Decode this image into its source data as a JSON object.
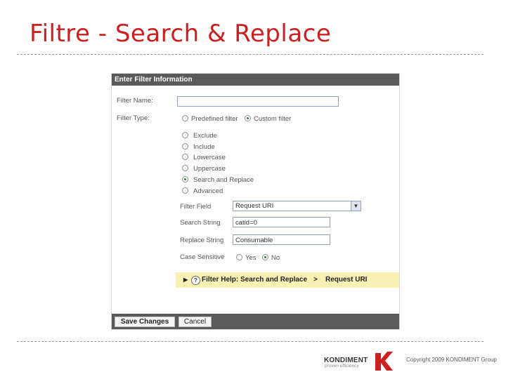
{
  "slide": {
    "title": "Filtre - Search & Replace"
  },
  "panel": {
    "header": "Enter Filter Information",
    "filter_name_label": "Filter Name:",
    "filter_name_value": "",
    "filter_type_label": "Filter Type:",
    "type_options": [
      {
        "label": "Predefined filter",
        "checked": false
      },
      {
        "label": "Custom filter",
        "checked": true
      }
    ],
    "custom_options": [
      {
        "label": "Exclude",
        "checked": false
      },
      {
        "label": "Include",
        "checked": false
      },
      {
        "label": "Lowercase",
        "checked": false
      },
      {
        "label": "Uppercase",
        "checked": false
      },
      {
        "label": "Search and Replace",
        "checked": true
      },
      {
        "label": "Advanced",
        "checked": false
      }
    ],
    "filter_field_label": "Filter Field",
    "filter_field_value": "Request URI",
    "search_string_label": "Search String",
    "search_string_value": "catid=0",
    "replace_string_label": "Replace String",
    "replace_string_value": "Consumable",
    "case_sensitive_label": "Case Sensitive",
    "case_options": [
      {
        "label": "Yes",
        "checked": false
      },
      {
        "label": "No",
        "checked": true
      }
    ],
    "help": {
      "text": "Filter Help: Search and Replace",
      "separator": ">",
      "topic": "Request URI"
    },
    "buttons": {
      "save": "Save Changes",
      "cancel": "Cancel"
    }
  },
  "footer": {
    "logo_name": "KONDIMENT",
    "logo_tagline": "proven efficiency",
    "copyright": "Copyright 2009 KONDIMENT Group"
  },
  "colors": {
    "title": "#cc1f1f",
    "header_bg": "#5a5a5a",
    "help_bg": "#f7f1b3",
    "logo_red": "#cc1f1f"
  }
}
